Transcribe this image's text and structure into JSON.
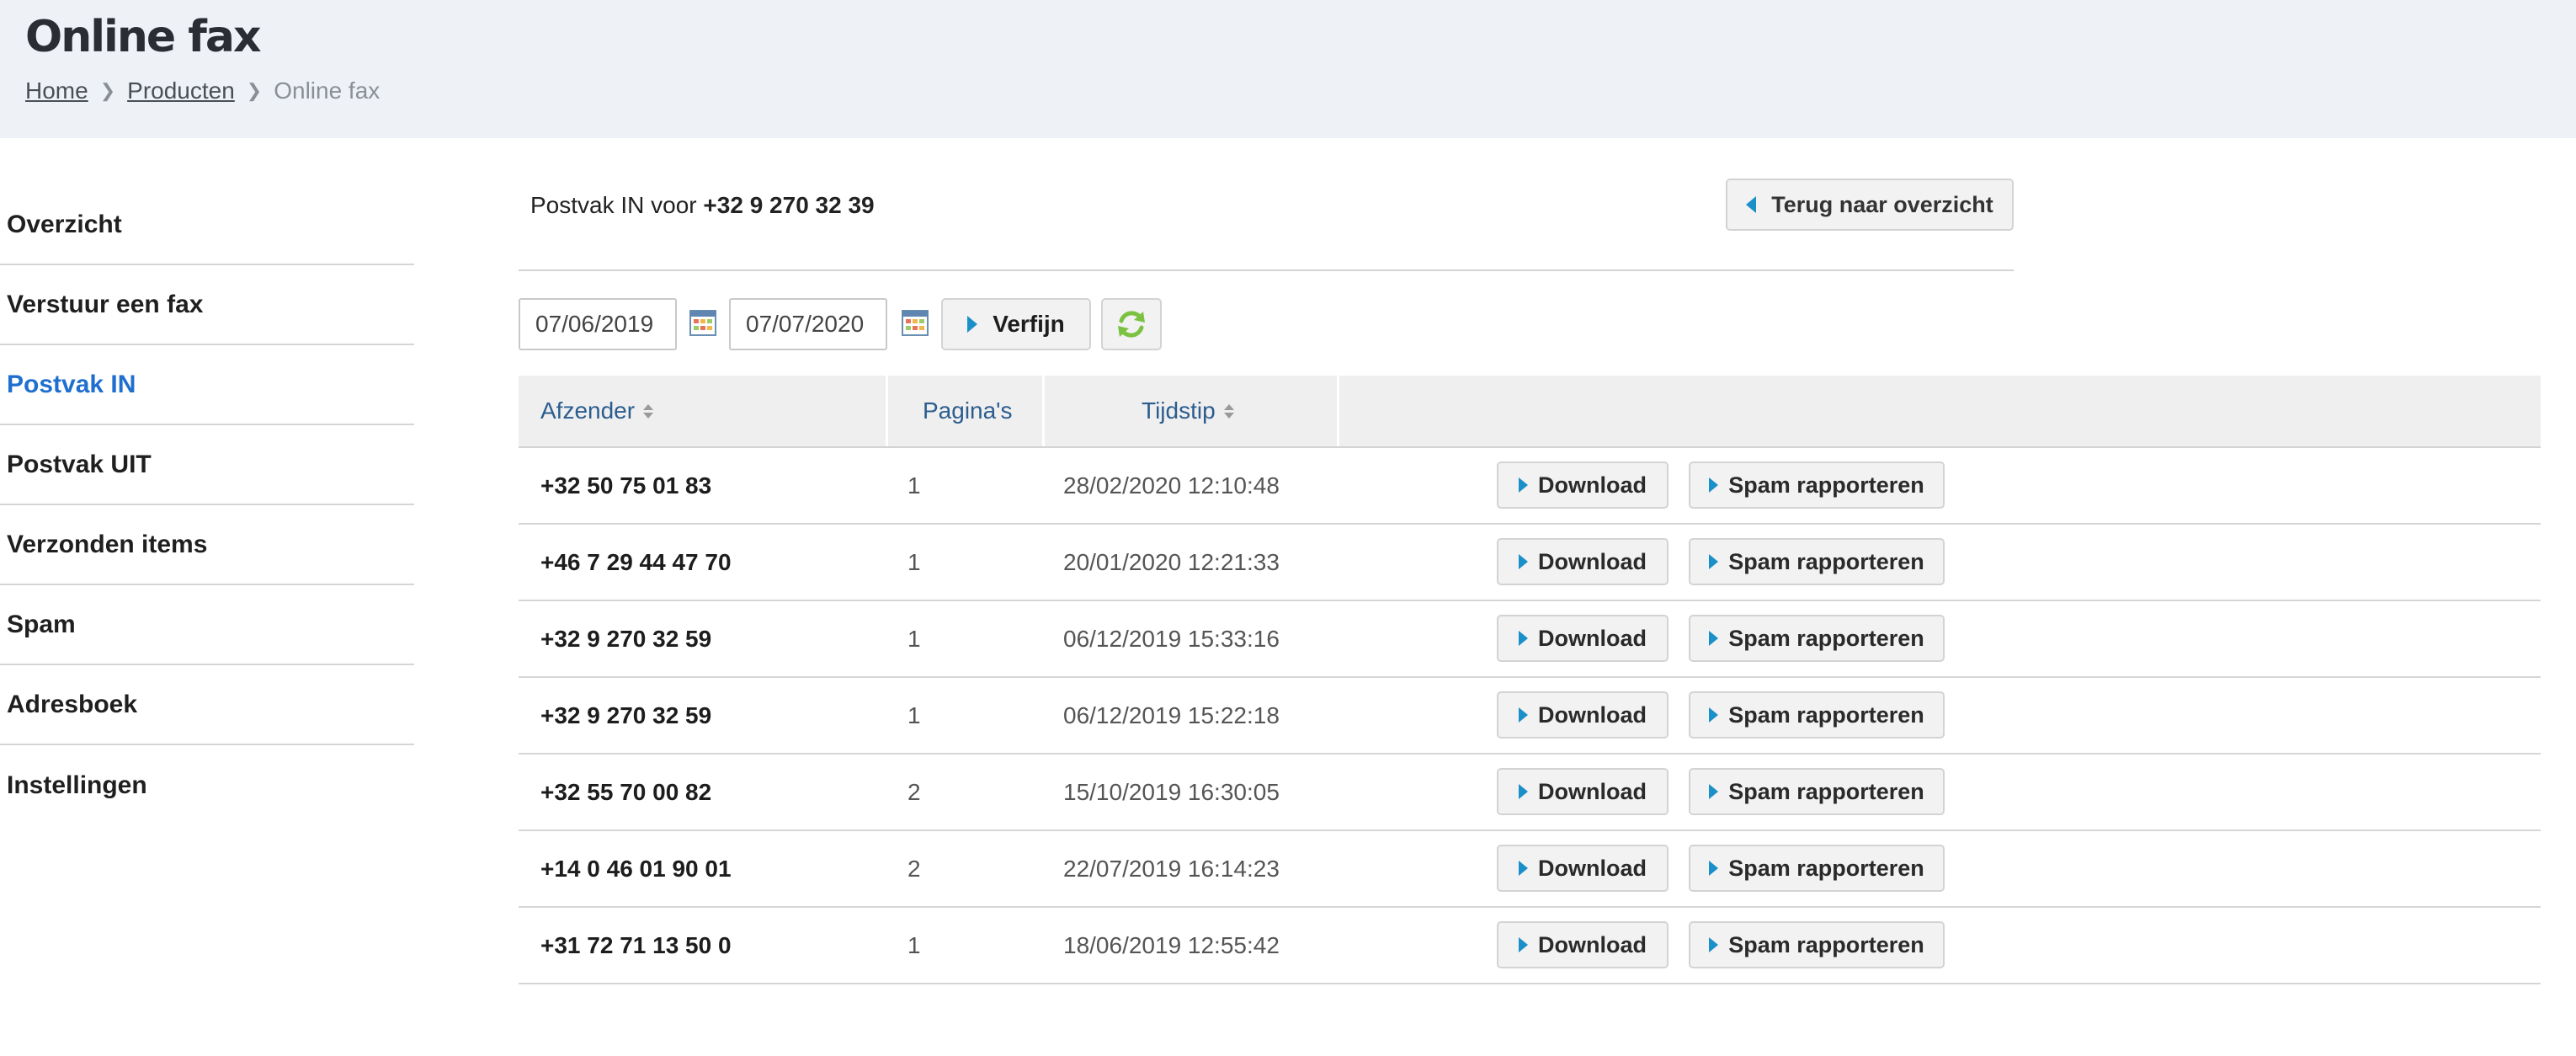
{
  "header": {
    "title": "Online fax",
    "breadcrumb": [
      {
        "label": "Home",
        "link": true
      },
      {
        "label": "Producten",
        "link": true
      },
      {
        "label": "Online fax",
        "link": false
      }
    ],
    "separator": "❯"
  },
  "sidebar": {
    "items": [
      {
        "label": "Overzicht",
        "active": false
      },
      {
        "label": "Verstuur een fax",
        "active": false
      },
      {
        "label": "Postvak IN",
        "active": true
      },
      {
        "label": "Postvak UIT",
        "active": false
      },
      {
        "label": "Verzonden items",
        "active": false
      },
      {
        "label": "Spam",
        "active": false
      },
      {
        "label": "Adresboek",
        "active": false
      },
      {
        "label": "Instellingen",
        "active": false
      }
    ]
  },
  "main": {
    "inbox_label": "Postvak IN voor",
    "inbox_number": "+32 9 270 32 39",
    "back_button": "Terug naar overzicht"
  },
  "filter": {
    "date_from": "07/06/2019",
    "date_to": "07/07/2020",
    "refine_button": "Verfijn"
  },
  "table": {
    "columns": {
      "sender": "Afzender",
      "pages": "Pagina's",
      "time": "Tijdstip"
    },
    "download_label": "Download",
    "spam_label": "Spam rapporteren",
    "rows": [
      {
        "sender": "+32 50 75 01 83",
        "pages": "1",
        "time": "28/02/2020 12:10:48"
      },
      {
        "sender": "+46 7 29 44 47 70",
        "pages": "1",
        "time": "20/01/2020 12:21:33"
      },
      {
        "sender": "+32 9 270 32 59",
        "pages": "1",
        "time": "06/12/2019 15:33:16"
      },
      {
        "sender": "+32 9 270 32 59",
        "pages": "1",
        "time": "06/12/2019 15:22:18"
      },
      {
        "sender": "+32 55 70 00 82",
        "pages": "2",
        "time": "15/10/2019 16:30:05"
      },
      {
        "sender": "+14 0 46 01 90 01",
        "pages": "2",
        "time": "22/07/2019 16:14:23"
      },
      {
        "sender": "+31 72 71 13 50 0",
        "pages": "1",
        "time": "18/06/2019 12:55:42"
      }
    ]
  },
  "colors": {
    "header_bg": "#eef2f6",
    "active_nav": "#1f6fd0",
    "accent_arrow": "#1a8fc8",
    "refresh_icon": "#7cc242",
    "column_header_text": "#2b5d8f"
  }
}
